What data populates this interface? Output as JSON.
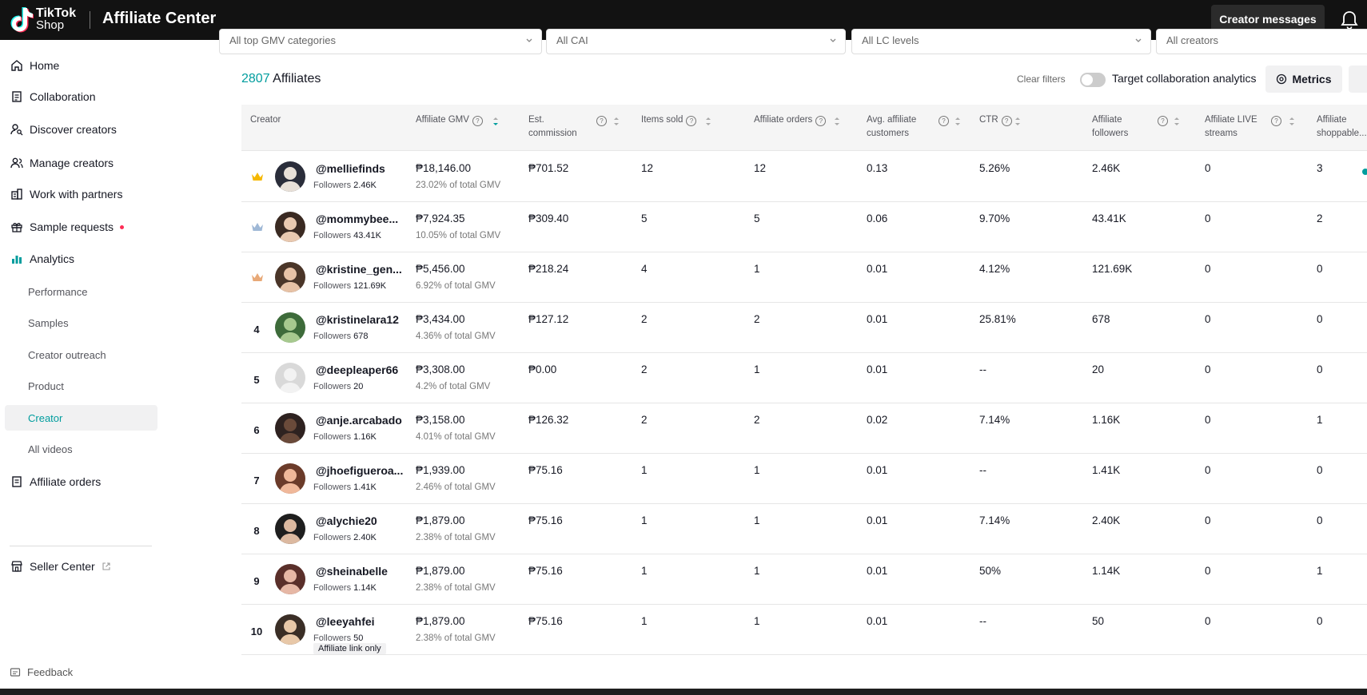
{
  "header": {
    "logo_line1": "TikTok",
    "logo_line2": "Shop",
    "title": "Affiliate Center",
    "creator_messages": "Creator messages"
  },
  "sidebar": {
    "items": [
      {
        "label": "Home",
        "icon": "home-icon"
      },
      {
        "label": "Collaboration",
        "icon": "clipboard-icon"
      },
      {
        "label": "Discover creators",
        "icon": "person-search-icon"
      },
      {
        "label": "Manage creators",
        "icon": "people-icon"
      },
      {
        "label": "Work with partners",
        "icon": "building-icon"
      },
      {
        "label": "Sample requests",
        "icon": "gift-icon"
      },
      {
        "label": "Analytics",
        "icon": "bar-chart-icon"
      }
    ],
    "analytics_sub": [
      "Performance",
      "Samples",
      "Creator outreach",
      "Product",
      "Creator",
      "All videos"
    ],
    "affiliate_orders": "Affiliate orders",
    "seller_center": "Seller Center",
    "feedback": "Feedback"
  },
  "filters": [
    "All top GMV categories",
    "All CAI",
    "All LC levels",
    "All creators"
  ],
  "summary": {
    "count": "2807",
    "label": "Affiliates",
    "clear_filters": "Clear filters",
    "toggle_label": "Target collaboration analytics",
    "metrics": "Metrics"
  },
  "columns": {
    "creator": "Creator",
    "gmv": "Affiliate GMV",
    "commission_1": "Est.",
    "commission_2": "commission",
    "items_sold": "Items sold",
    "orders": "Affiliate orders",
    "customers_1": "Avg. affiliate",
    "customers_2": "customers",
    "ctr": "CTR",
    "followers_1": "Affiliate",
    "followers_2": "followers",
    "live_1": "Affiliate LIVE",
    "live_2": "streams",
    "shoppable_1": "Affiliate",
    "shoppable_2": "shoppable..."
  },
  "followers_prefix": "Followers",
  "rows": [
    {
      "rank": "",
      "medal": "gold",
      "handle": "@melliefinds",
      "followers": "2.46K",
      "gmv": "₱18,146.00",
      "share": "23.02% of total GMV",
      "commission": "₱701.52",
      "items": "12",
      "orders": "12",
      "customers": "0.13",
      "ctr": "5.26%",
      "aff_followers": "2.46K",
      "live": "0",
      "shoppable": "3"
    },
    {
      "rank": "",
      "medal": "silver",
      "handle": "@mommybee...",
      "followers": "43.41K",
      "gmv": "₱7,924.35",
      "share": "10.05% of total GMV",
      "commission": "₱309.40",
      "items": "5",
      "orders": "5",
      "customers": "0.06",
      "ctr": "9.70%",
      "aff_followers": "43.41K",
      "live": "0",
      "shoppable": "2"
    },
    {
      "rank": "",
      "medal": "bronze",
      "handle": "@kristine_gen...",
      "followers": "121.69K",
      "gmv": "₱5,456.00",
      "share": "6.92% of total GMV",
      "commission": "₱218.24",
      "items": "4",
      "orders": "1",
      "customers": "0.01",
      "ctr": "4.12%",
      "aff_followers": "121.69K",
      "live": "0",
      "shoppable": "0"
    },
    {
      "rank": "4",
      "medal": "",
      "handle": "@kristinelara12",
      "followers": "678",
      "gmv": "₱3,434.00",
      "share": "4.36% of total GMV",
      "commission": "₱127.12",
      "items": "2",
      "orders": "2",
      "customers": "0.01",
      "ctr": "25.81%",
      "aff_followers": "678",
      "live": "0",
      "shoppable": "0"
    },
    {
      "rank": "5",
      "medal": "",
      "handle": "@deepleaper66",
      "followers": "20",
      "gmv": "₱3,308.00",
      "share": "4.2% of total GMV",
      "commission": "₱0.00",
      "items": "2",
      "orders": "1",
      "customers": "0.01",
      "ctr": "--",
      "aff_followers": "20",
      "live": "0",
      "shoppable": "0"
    },
    {
      "rank": "6",
      "medal": "",
      "handle": "@anje.arcabado",
      "followers": "1.16K",
      "gmv": "₱3,158.00",
      "share": "4.01% of total GMV",
      "commission": "₱126.32",
      "items": "2",
      "orders": "2",
      "customers": "0.02",
      "ctr": "7.14%",
      "aff_followers": "1.16K",
      "live": "0",
      "shoppable": "1"
    },
    {
      "rank": "7",
      "medal": "",
      "handle": "@jhoefigueroa...",
      "followers": "1.41K",
      "gmv": "₱1,939.00",
      "share": "2.46% of total GMV",
      "commission": "₱75.16",
      "items": "1",
      "orders": "1",
      "customers": "0.01",
      "ctr": "--",
      "aff_followers": "1.41K",
      "live": "0",
      "shoppable": "0"
    },
    {
      "rank": "8",
      "medal": "",
      "handle": "@alychie20",
      "followers": "2.40K",
      "gmv": "₱1,879.00",
      "share": "2.38% of total GMV",
      "commission": "₱75.16",
      "items": "1",
      "orders": "1",
      "customers": "0.01",
      "ctr": "7.14%",
      "aff_followers": "2.40K",
      "live": "0",
      "shoppable": "0"
    },
    {
      "rank": "9",
      "medal": "",
      "handle": "@sheinabelle",
      "followers": "1.14K",
      "gmv": "₱1,879.00",
      "share": "2.38% of total GMV",
      "commission": "₱75.16",
      "items": "1",
      "orders": "1",
      "customers": "0.01",
      "ctr": "50%",
      "aff_followers": "1.14K",
      "live": "0",
      "shoppable": "1"
    },
    {
      "rank": "10",
      "medal": "",
      "handle": "@leeyahfei",
      "followers": "50",
      "gmv": "₱1,879.00",
      "share": "2.38% of total GMV",
      "commission": "₱75.16",
      "items": "1",
      "orders": "1",
      "customers": "0.01",
      "ctr": "--",
      "aff_followers": "50",
      "live": "0",
      "shoppable": "0",
      "badge": "Affiliate link only"
    }
  ],
  "colors": {
    "accent": "#019d9e",
    "topbar": "#121212",
    "active_bg": "#f1f1f2",
    "dot": "#fe2c55"
  }
}
